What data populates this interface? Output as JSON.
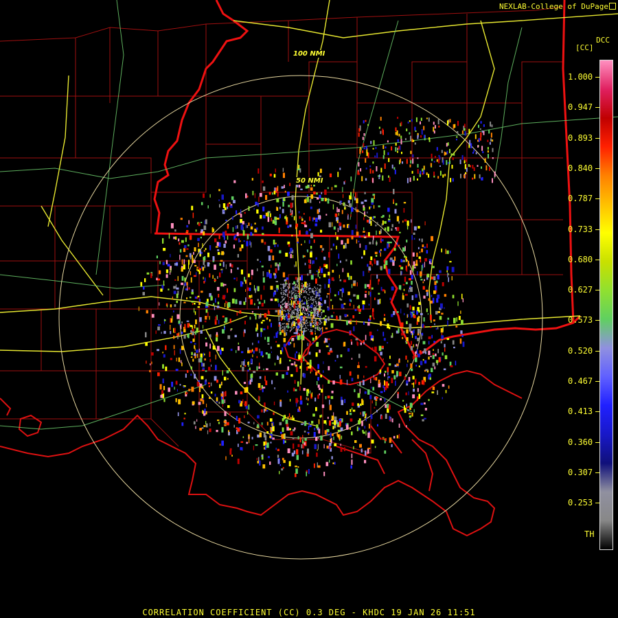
{
  "credit": "NEXLAB-College of DuPage",
  "product_code": "DCC",
  "unit_label": "[CC]",
  "ring_labels": [
    "100 NMI",
    "50 NMI"
  ],
  "colorbar": {
    "ticks": [
      "1.000",
      "0.947",
      "0.893",
      "0.840",
      "0.787",
      "0.733",
      "0.680",
      "0.627",
      "0.573",
      "0.520",
      "0.467",
      "0.413",
      "0.360",
      "0.307",
      "0.253"
    ],
    "threshold_label": "TH",
    "colors": [
      "#000000",
      "#888888",
      "#9090a0",
      "#10107a",
      "#1818c8",
      "#2020ff",
      "#6060ff",
      "#9090e0",
      "#60d060",
      "#90e030",
      "#c8e000",
      "#ffff00",
      "#ffc000",
      "#ff8000",
      "#ff2000",
      "#c00000",
      "#e02060",
      "#ff90c0"
    ]
  },
  "caption": "CORRELATION COEFFICIENT (CC) 0.3 DEG - KHDC 19 JAN 26 11:51"
}
